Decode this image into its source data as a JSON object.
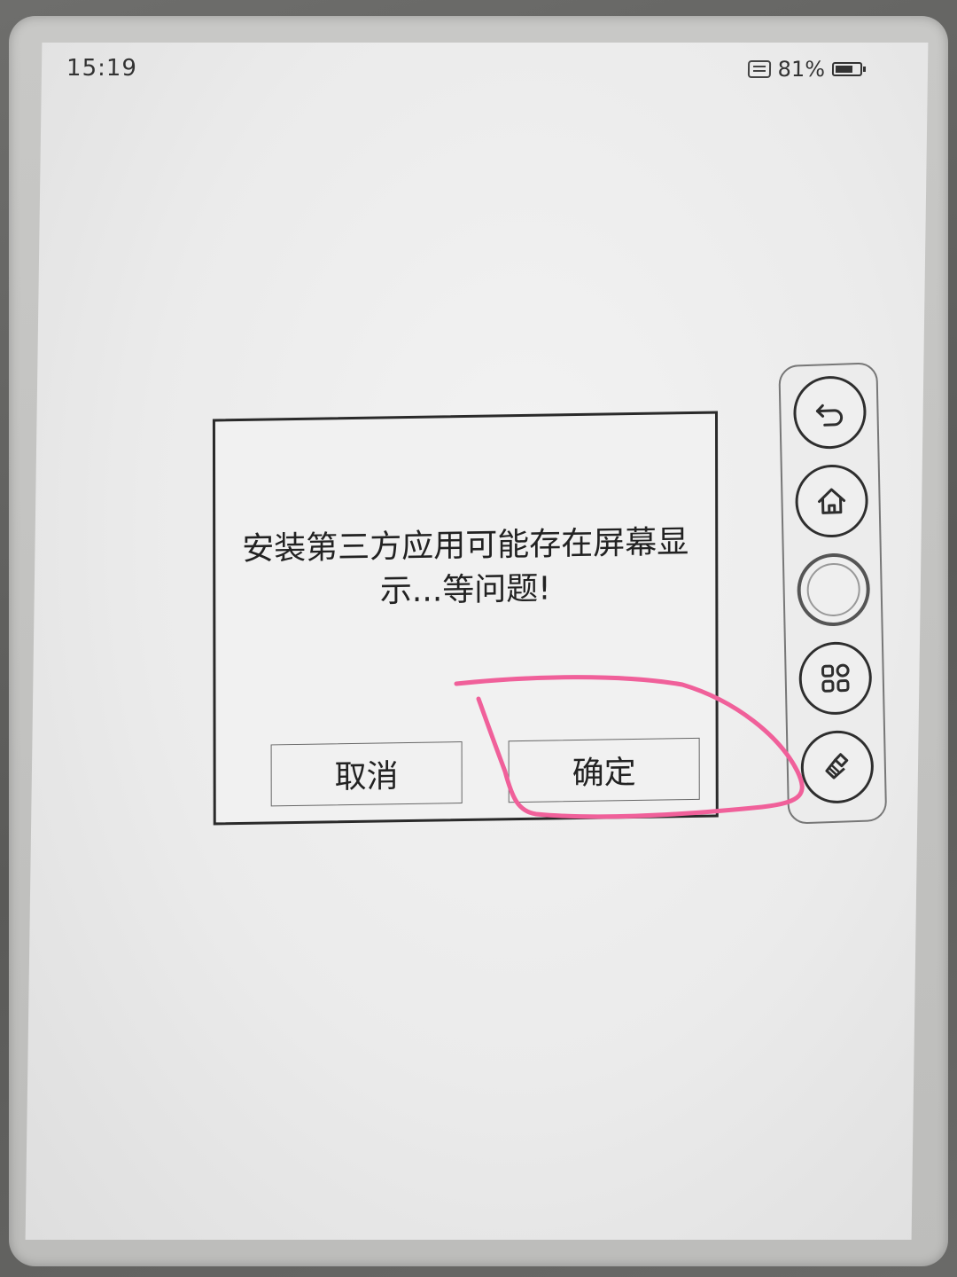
{
  "status_bar": {
    "time": "15:19",
    "battery_percent": "81%",
    "battery_level": 0.81
  },
  "dialog": {
    "message": "安装第三方应用可能存在屏幕显示...等问题!",
    "cancel_label": "取消",
    "confirm_label": "确定"
  },
  "float_panel": {
    "buttons": [
      {
        "icon": "back-icon"
      },
      {
        "icon": "home-icon"
      },
      {
        "icon": "circle-icon"
      },
      {
        "icon": "apps-icon"
      },
      {
        "icon": "clean-brush-icon"
      }
    ]
  },
  "colors": {
    "annotation": "#f0609a",
    "screen_bg": "#efefef",
    "ink": "#222222"
  }
}
